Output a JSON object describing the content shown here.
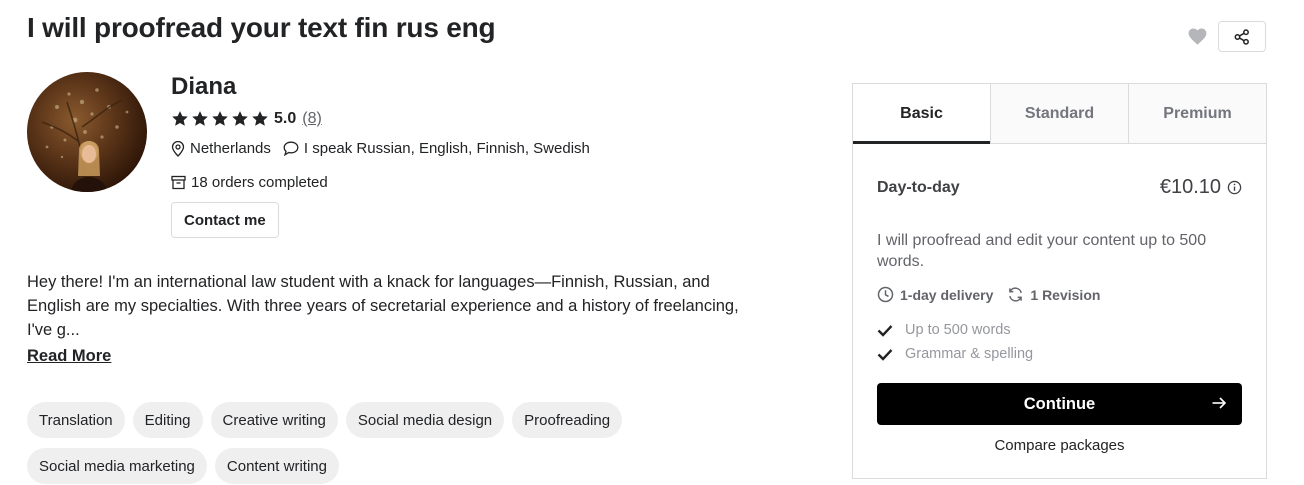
{
  "gig": {
    "title": "I will proofread your text fin rus eng"
  },
  "seller": {
    "name": "Diana",
    "rating": "5.0",
    "rating_count": "(8)",
    "stars": 5,
    "location": "Netherlands",
    "languages": "I speak Russian, English, Finnish, Swedish",
    "orders": "18 orders completed",
    "contact_label": "Contact me"
  },
  "description": {
    "text": "Hey there! I'm an international law student with a knack for languages—Finnish, Russian, and English are my specialties. With three years of secretarial experience and a history of freelancing, I've g...",
    "read_more": "Read More"
  },
  "tags": [
    "Translation",
    "Editing",
    "Creative writing",
    "Social media design",
    "Proofreading",
    "Social media marketing",
    "Content writing"
  ],
  "package": {
    "tabs": [
      "Basic",
      "Standard",
      "Premium"
    ],
    "active_tab": "Basic",
    "name": "Day-to-day",
    "price": "€10.10",
    "description": "I will proofread and edit your content up to 500 words.",
    "delivery": "1-day delivery",
    "revisions": "1 Revision",
    "features": [
      "Up to 500 words",
      "Grammar & spelling"
    ],
    "continue_label": "Continue",
    "compare_label": "Compare packages"
  },
  "colors": {
    "text": "#222325",
    "muted": "#62646a",
    "border": "#dadbdd",
    "tag_bg": "#efeff0",
    "button": "#000000",
    "heart": "#b5b6ba"
  },
  "icons": {
    "favorite": "heart-icon",
    "share": "share-icon",
    "location": "location-pin-icon",
    "language": "chat-bubble-icon",
    "orders": "archive-box-icon",
    "info": "info-icon",
    "delivery": "clock-icon",
    "revision": "refresh-icon",
    "feature": "checkmark-icon",
    "continue": "arrow-right-icon"
  }
}
